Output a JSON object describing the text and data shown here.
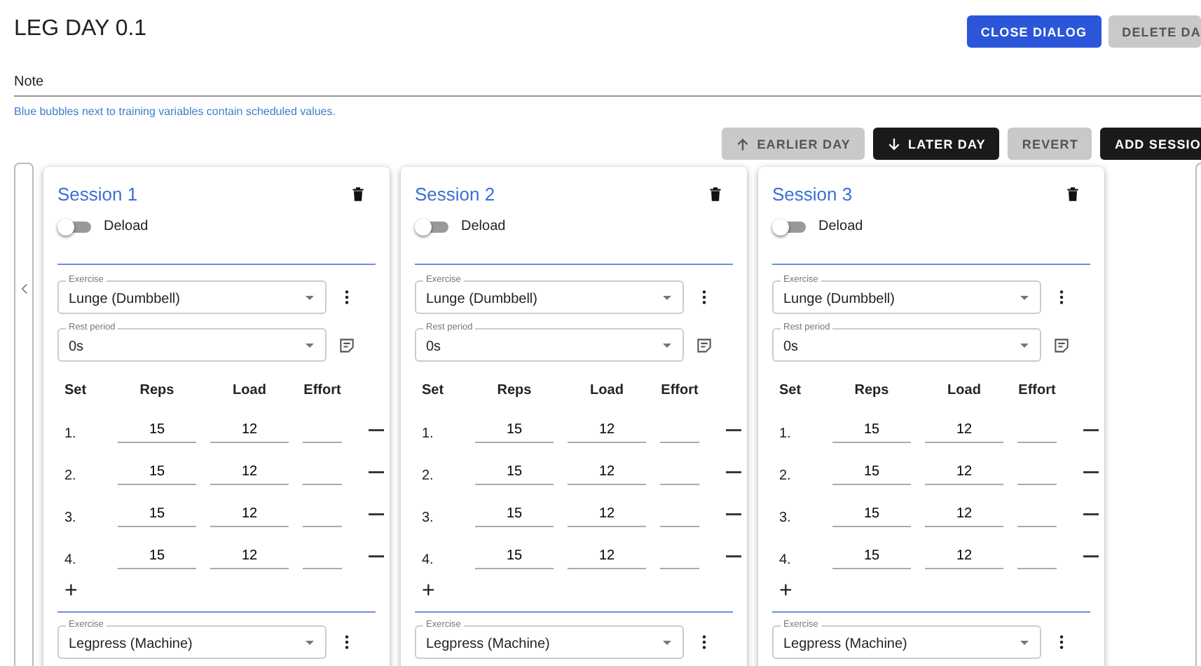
{
  "dialog": {
    "title": "LEG DAY 0.1",
    "buttons": [
      {
        "label": "CLOSE DIALOG",
        "kind": "primary"
      },
      {
        "label": "DELETE DA",
        "kind": "muted"
      }
    ]
  },
  "note": {
    "placeholder": "Note"
  },
  "hint": "Blue bubbles next to training variables contain scheduled values.",
  "toolbar": [
    {
      "label": "EARLIER DAY",
      "kind": "earlier"
    },
    {
      "label": "LATER DAY",
      "kind": "later"
    },
    {
      "label": "REVERT",
      "kind": "revert"
    },
    {
      "label": "ADD SESSIO",
      "kind": "add"
    }
  ],
  "sessions": [
    {
      "title": "Session 1",
      "deload_label": "Deload",
      "deload": false,
      "columns": [
        "Set",
        "Reps",
        "Load",
        "Effort"
      ],
      "exercises": [
        {
          "exercise_label": "Exercise",
          "exercise": "Lunge (Dumbbell)",
          "rest_label": "Rest period",
          "rest": "0s",
          "sets": [
            {
              "set": "1.",
              "reps": "15",
              "load": "12"
            },
            {
              "set": "2.",
              "reps": "15",
              "load": "12"
            },
            {
              "set": "3.",
              "reps": "15",
              "load": "12"
            },
            {
              "set": "4.",
              "reps": "15",
              "load": "12"
            }
          ],
          "add": "+"
        },
        {
          "exercise_label": "Exercise",
          "exercise": "Legpress (Machine)"
        }
      ]
    },
    {
      "title": "Session 2",
      "deload_label": "Deload",
      "deload": false,
      "columns": [
        "Set",
        "Reps",
        "Load",
        "Effort"
      ],
      "exercises": [
        {
          "exercise_label": "Exercise",
          "exercise": "Lunge (Dumbbell)",
          "rest_label": "Rest period",
          "rest": "0s",
          "sets": [
            {
              "set": "1.",
              "reps": "15",
              "load": "12"
            },
            {
              "set": "2.",
              "reps": "15",
              "load": "12"
            },
            {
              "set": "3.",
              "reps": "15",
              "load": "12"
            },
            {
              "set": "4.",
              "reps": "15",
              "load": "12"
            }
          ],
          "add": "+"
        },
        {
          "exercise_label": "Exercise",
          "exercise": "Legpress (Machine)"
        }
      ]
    },
    {
      "title": "Session 3",
      "deload_label": "Deload",
      "deload": false,
      "columns": [
        "Set",
        "Reps",
        "Load",
        "Effort"
      ],
      "exercises": [
        {
          "exercise_label": "Exercise",
          "exercise": "Lunge (Dumbbell)",
          "rest_label": "Rest period",
          "rest": "0s",
          "sets": [
            {
              "set": "1.",
              "reps": "15",
              "load": "12"
            },
            {
              "set": "2.",
              "reps": "15",
              "load": "12"
            },
            {
              "set": "3.",
              "reps": "15",
              "load": "12"
            },
            {
              "set": "4.",
              "reps": "15",
              "load": "12"
            }
          ],
          "add": "+"
        },
        {
          "exercise_label": "Exercise",
          "exercise": "Legpress (Machine)"
        }
      ]
    }
  ]
}
